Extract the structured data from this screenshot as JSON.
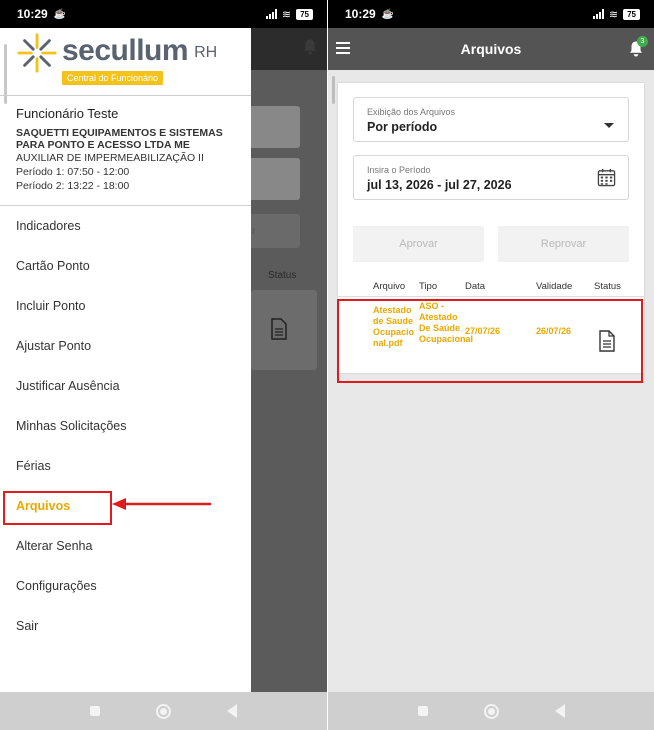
{
  "status_bar": {
    "time": "10:29",
    "battery": "75"
  },
  "left": {
    "logo": {
      "name": "secullum",
      "suffix": "RH",
      "tagline": "Central do Funcionário"
    },
    "profile": {
      "name": "Funcionário Teste",
      "company": "SAQUETTI EQUIPAMENTOS E SISTEMAS PARA PONTO E ACESSO LTDA ME",
      "role": "AUXILIAR  DE IMPERMEABILIZAÇÃO II",
      "period1": "Período 1: 07:50 - 12:00",
      "period2": "Período 2: 13:22 - 18:00"
    },
    "menu": [
      {
        "label": "Indicadores"
      },
      {
        "label": "Cartão Ponto"
      },
      {
        "label": "Incluir Ponto"
      },
      {
        "label": "Ajustar Ponto"
      },
      {
        "label": "Justificar Ausência"
      },
      {
        "label": "Minhas Solicitações"
      },
      {
        "label": "Férias"
      },
      {
        "label": "Arquivos"
      },
      {
        "label": "Alterar Senha"
      },
      {
        "label": "Configurações"
      },
      {
        "label": "Sair"
      }
    ],
    "background": {
      "status_header": "Status",
      "button_fragment": "r"
    }
  },
  "right": {
    "header": {
      "title": "Arquivos",
      "notification_count": "3"
    },
    "display_field": {
      "label": "Exibição dos Arquivos",
      "value": "Por período"
    },
    "period_field": {
      "label": "Insira o Período",
      "value": "jul 13, 2026 - jul 27, 2026"
    },
    "buttons": {
      "approve": "Aprovar",
      "reject": "Reprovar"
    },
    "table": {
      "headers": {
        "file": "Arquivo",
        "type": "Tipo",
        "date": "Data",
        "validity": "Validade",
        "status": "Status"
      },
      "rows": [
        {
          "file": "Atestado de Saude Ocupacional.pdf",
          "type": "ASO - Atestado De Saúde Ocupacional",
          "date": "27/07/26",
          "validity": "26/07/26"
        }
      ]
    }
  },
  "colors": {
    "accent": "#e8a900",
    "header": "#545454",
    "highlight": "#e01b1b",
    "badge": "#3fae49",
    "logo_tag": "#f3c21b"
  }
}
